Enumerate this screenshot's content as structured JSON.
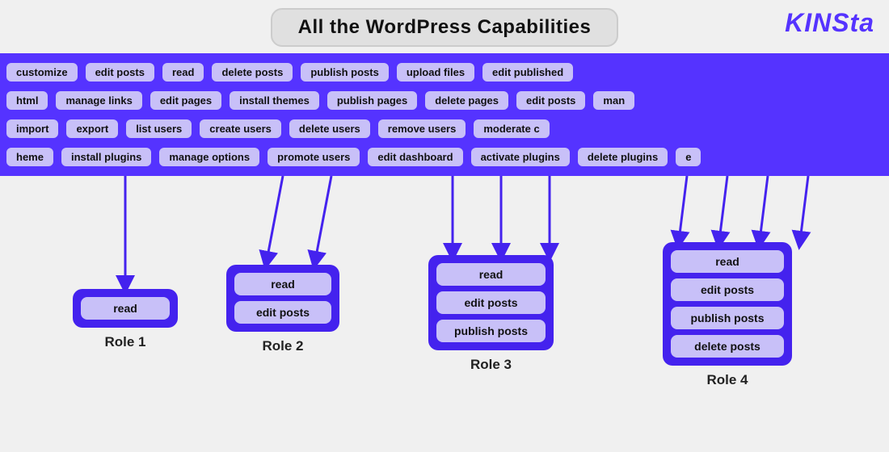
{
  "header": {
    "title": "All the WordPress Capabilities",
    "logo": "KINSta"
  },
  "capabilities": {
    "row1": [
      "customize",
      "edit posts",
      "read",
      "delete posts",
      "publish posts",
      "upload files",
      "edit published"
    ],
    "row2": [
      "html",
      "manage links",
      "edit pages",
      "install themes",
      "publish pages",
      "delete pages",
      "edit posts",
      "man"
    ],
    "row3": [
      "import",
      "export",
      "list users",
      "create users",
      "delete users",
      "remove users",
      "moderate c"
    ],
    "row4": [
      "heme",
      "install plugins",
      "manage options",
      "promote users",
      "edit dashboard",
      "activate plugins",
      "delete plugins",
      "e"
    ]
  },
  "roles": [
    {
      "id": "role1",
      "label": "Role 1",
      "capabilities": [
        "read"
      ]
    },
    {
      "id": "role2",
      "label": "Role 2",
      "capabilities": [
        "read",
        "edit posts"
      ]
    },
    {
      "id": "role3",
      "label": "Role 3",
      "capabilities": [
        "read",
        "edit posts",
        "publish posts"
      ]
    },
    {
      "id": "role4",
      "label": "Role 4",
      "capabilities": [
        "read",
        "edit posts",
        "publish posts",
        "delete posts"
      ]
    }
  ]
}
